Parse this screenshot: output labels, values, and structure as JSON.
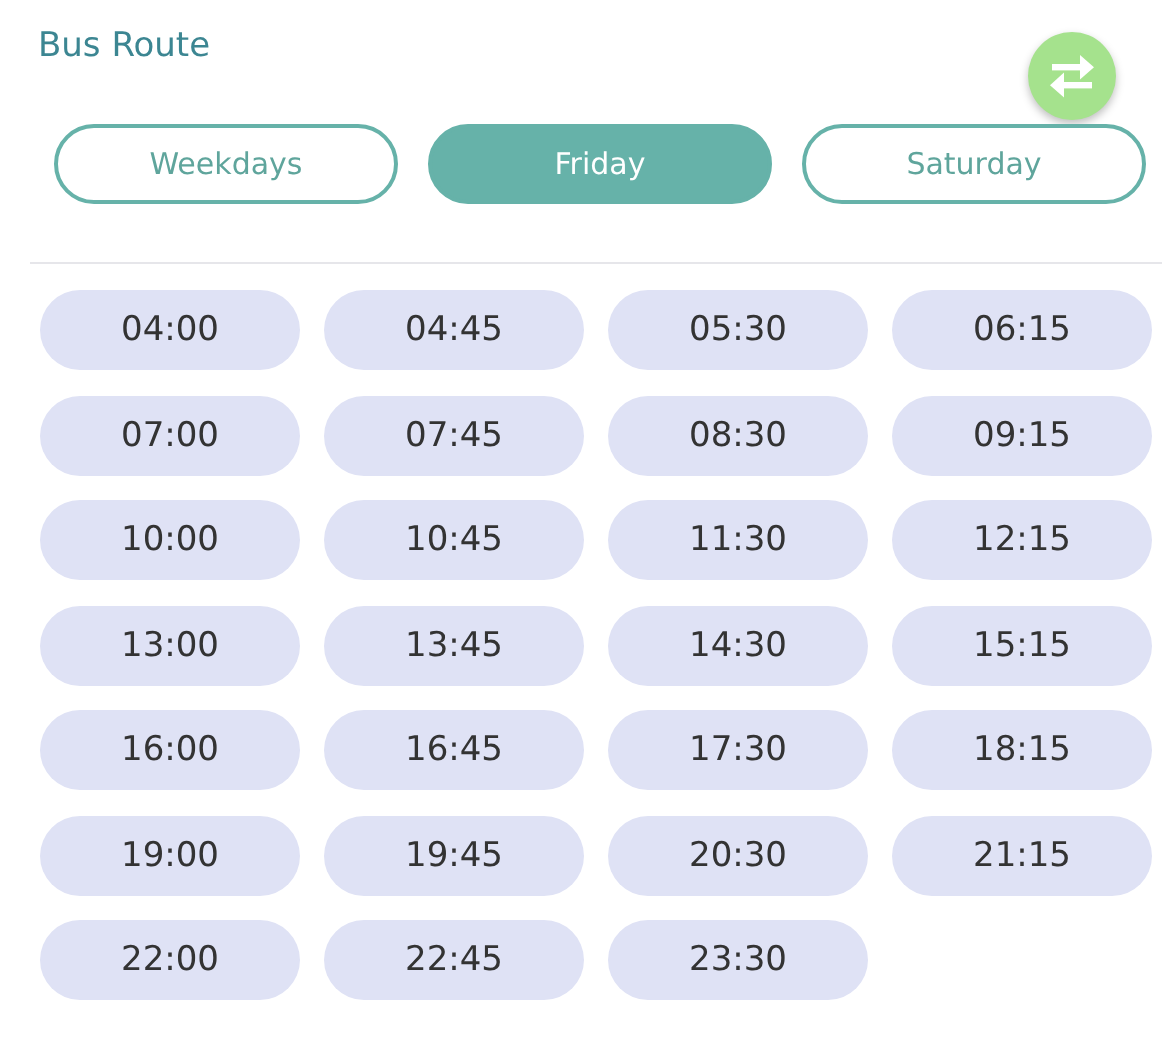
{
  "title": "Bus Route",
  "tabs": [
    {
      "label": "Weekdays",
      "selected": false
    },
    {
      "label": "Friday",
      "selected": true
    },
    {
      "label": "Saturday",
      "selected": false
    }
  ],
  "times": [
    "04:00",
    "04:45",
    "05:30",
    "06:15",
    "07:00",
    "07:45",
    "08:30",
    "09:15",
    "10:00",
    "10:45",
    "11:30",
    "12:15",
    "13:00",
    "13:45",
    "14:30",
    "15:15",
    "16:00",
    "16:45",
    "17:30",
    "18:15",
    "19:00",
    "19:45",
    "20:30",
    "21:15",
    "22:00",
    "22:45",
    "23:30"
  ]
}
